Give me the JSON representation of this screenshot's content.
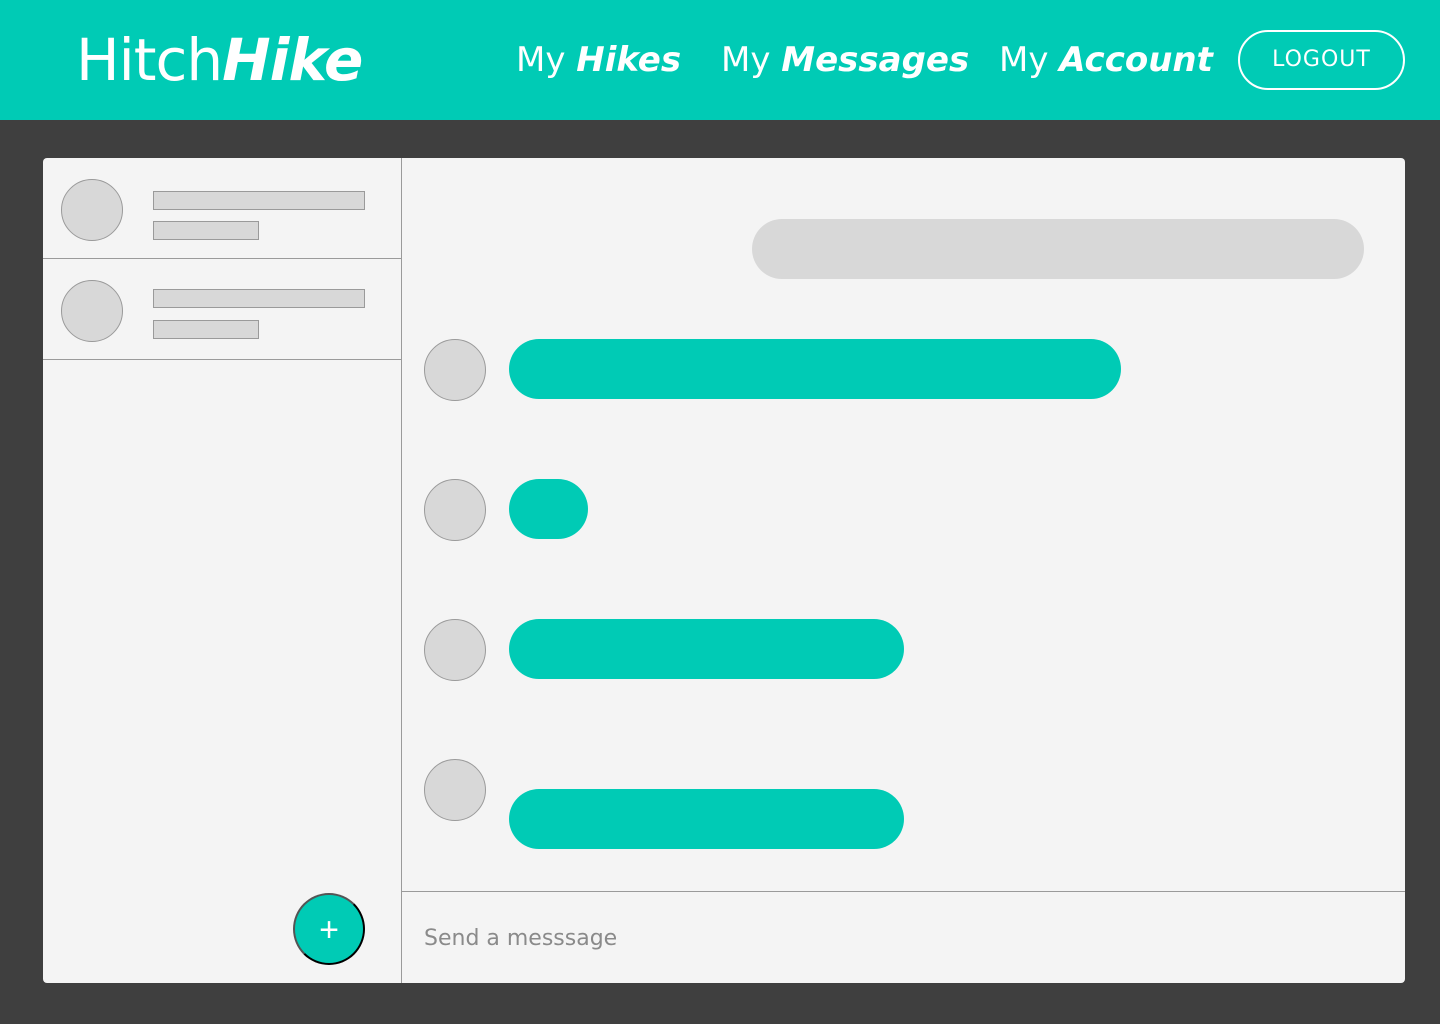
{
  "brand": {
    "part1": "Hitch",
    "part2": "Hike"
  },
  "nav": {
    "hikes": {
      "prefix": "My",
      "label": "Hikes"
    },
    "messages": {
      "prefix": "My",
      "label": "Messages"
    },
    "account": {
      "prefix": "My",
      "label": "Account"
    },
    "logout": "LOGOUT"
  },
  "sidebar": {
    "conversations": [
      {},
      {}
    ],
    "new_button": "+"
  },
  "composer": {
    "placeholder": "Send a messsage"
  },
  "colors": {
    "accent": "#00cbb5",
    "background": "#3f3f3f",
    "panel": "#f4f4f4",
    "placeholder": "#d8d8d8"
  }
}
